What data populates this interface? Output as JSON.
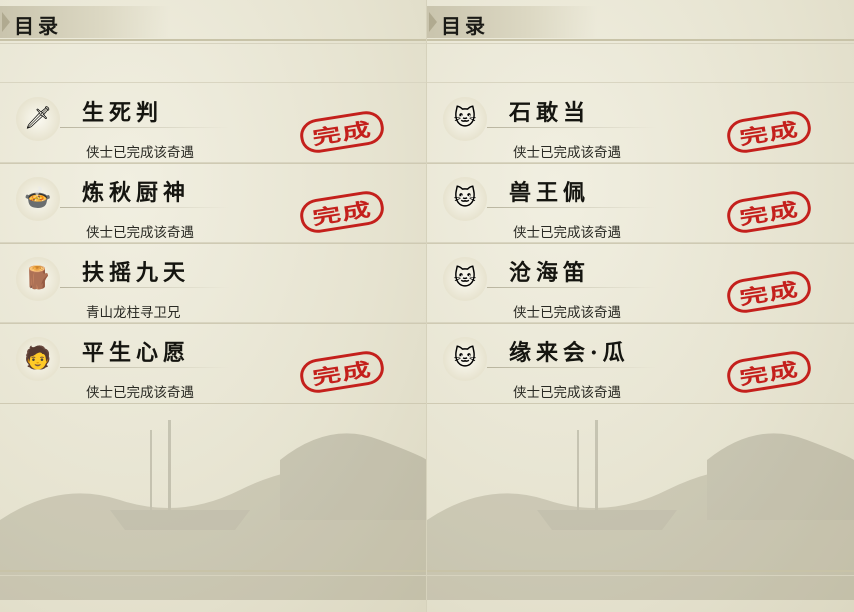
{
  "left_panel": {
    "title": "目录",
    "entries": [
      {
        "icon": "sword-gold-icon",
        "glyph": "🗡",
        "title": "生死判",
        "desc": "侠士已完成该奇遇",
        "completed": true,
        "stamp": "完成"
      },
      {
        "icon": "cooking-pot-icon",
        "glyph": "🍲",
        "title": "炼秋厨神",
        "desc": "侠士已完成该奇遇",
        "completed": true,
        "stamp": "完成"
      },
      {
        "icon": "wooden-pillar-icon",
        "glyph": "🪵",
        "title": "扶摇九天",
        "desc": "青山龙柱寻卫兄",
        "completed": false,
        "stamp": ""
      },
      {
        "icon": "character-avatar-icon",
        "glyph": "🧑",
        "title": "平生心愿",
        "desc": "侠士已完成该奇遇",
        "completed": true,
        "stamp": "完成"
      }
    ]
  },
  "right_panel": {
    "title": "目录",
    "entries": [
      {
        "icon": "cat-avatar-icon",
        "glyph": "🐱",
        "title": "石敢当",
        "desc": "侠士已完成该奇遇",
        "completed": true,
        "stamp": "完成"
      },
      {
        "icon": "cat-avatar-icon",
        "glyph": "🐱",
        "title": "兽王佩",
        "desc": "侠士已完成该奇遇",
        "completed": true,
        "stamp": "完成"
      },
      {
        "icon": "cat-avatar-icon",
        "glyph": "🐱",
        "title": "沧海笛",
        "desc": "侠士已完成该奇遇",
        "completed": true,
        "stamp": "完成"
      },
      {
        "icon": "cat-avatar-icon",
        "glyph": "🐱",
        "title": "缘来会·瓜",
        "desc": "侠士已完成该奇遇",
        "completed": true,
        "stamp": "完成"
      }
    ]
  },
  "colors": {
    "stamp_red": "#c4201c",
    "paper": "#e9e6d6",
    "ink": "#151510"
  }
}
